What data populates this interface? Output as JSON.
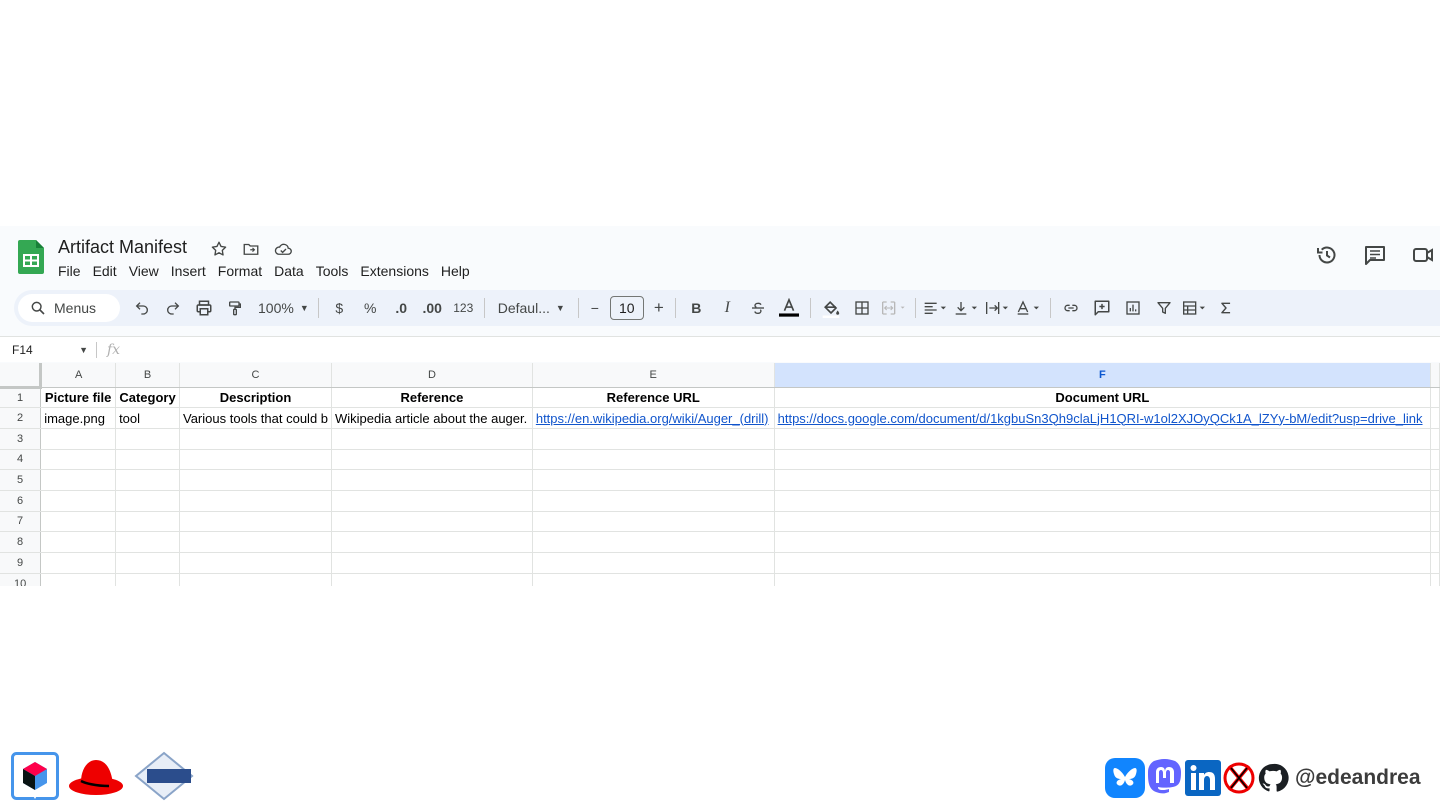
{
  "doc": {
    "title": "Artifact Manifest"
  },
  "menu": [
    "File",
    "Edit",
    "View",
    "Insert",
    "Format",
    "Data",
    "Tools",
    "Extensions",
    "Help"
  ],
  "toolbar": {
    "search_placeholder": "Menus",
    "zoom": "100%",
    "currency": "$",
    "percent": "%",
    "decrease_decimal": ".0",
    "increase_decimal": ".00",
    "number_format": "123",
    "font": "Defaul...",
    "font_size": "10",
    "minus": "−",
    "plus": "+",
    "bold": "B",
    "italic": "I"
  },
  "formula_bar": {
    "cell_ref": "F14",
    "fx": "fx"
  },
  "grid": {
    "columns": [
      "A",
      "B",
      "C",
      "D",
      "E",
      "F"
    ],
    "selected_column": "F",
    "row_numbers": [
      "1",
      "2",
      "3",
      "4",
      "5",
      "6",
      "7",
      "8",
      "9",
      "10"
    ],
    "headers": [
      "Picture file",
      "Category",
      "Description",
      "Reference",
      "Reference URL",
      "Document URL"
    ],
    "row2": {
      "a": "image.png",
      "b": "tool",
      "c": "Various tools that could b",
      "d": "Wikipedia article about the auger.",
      "e": "https://en.wikipedia.org/wiki/Auger_(drill)",
      "f": "https://docs.google.com/document/d/1kgbuSn3Qh9claLjH1QRI-w1ol2XJOyQCk1A_lZYy-bM/edit?usp=drive_link"
    }
  },
  "footer": {
    "handle": "@edeandrea"
  },
  "colors": {
    "accent": "#0b57d0",
    "link": "#1155cc",
    "sheets_green": "#188038",
    "toolbar_bg": "#edf2fa"
  }
}
